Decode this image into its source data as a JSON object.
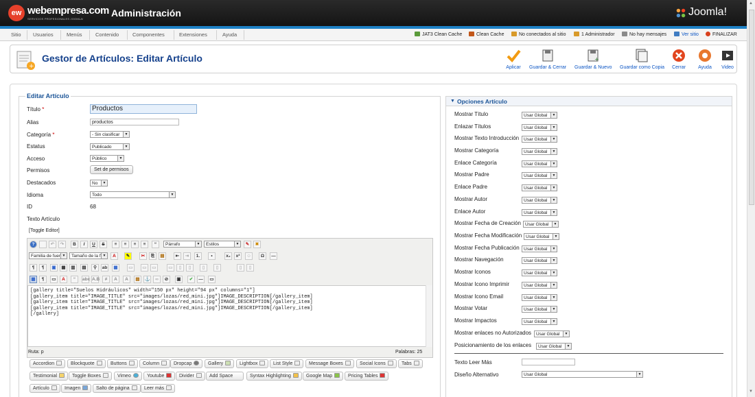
{
  "brand": {
    "logo_mark": "ew",
    "logo_text": "webempresa.com",
    "logo_sub": "SERVICIOS PROFESIONALES JOOMLA!",
    "admin_title": "Administración",
    "joomla": "Joomla!"
  },
  "menu": [
    "Sitio",
    "Usuarios",
    "Menús",
    "Contenido",
    "Componentes",
    "Extensiones",
    "Ayuda"
  ],
  "status_items": [
    "JAT3 Clean Cache",
    "Clean Cache",
    "No conectados al sitio",
    "1 Administrador",
    "No hay mensajes",
    "Ver sitio",
    "FINALIZAR"
  ],
  "page_title": "Gestor de Artículos: Editar Artículo",
  "toolbar": [
    "Aplicar",
    "Guardar & Cerrar",
    "Guardar & Nuevo",
    "Guardar como Copia",
    "Cerrar",
    "Ayuda",
    "Video"
  ],
  "form": {
    "legend": "Editar Artículo",
    "labels": {
      "titulo": "Título",
      "alias": "Alias",
      "categoria": "Categoría",
      "estatus": "Estatus",
      "acceso": "Acceso",
      "permisos": "Permisos",
      "destacados": "Destacados",
      "idioma": "Idioma",
      "id": "ID",
      "texto": "Texto Artículo"
    },
    "required_mark": "*",
    "values": {
      "titulo": "Productos",
      "alias": "productos",
      "categoria": "- Sin clasificar",
      "estatus": "Publicado",
      "acceso": "Público",
      "permisos_button": "Set de permisos",
      "destacados": "No",
      "idioma": "Todo",
      "id": "68"
    },
    "toggle_editor": "[Toggle Editor]"
  },
  "editor": {
    "format_select": "Párrafo",
    "styles_select": "Estilos",
    "font_family": "Familia de fuer",
    "font_size": "Tamaño de la fu",
    "content": "[gallery title=\"Suelos Hidráulicos\" width=\"150 px\" height=\"94 px\" columns=\"1\"]\n[gallery_item title=\"IMAGE_TITLE\" src=\"images/lozas/red_mini.jpg\"]IMAGE_DESCRIPTION[/gallery_item]\n[gallery_item title=\"IMAGE_TITLE\" src=\"images/lozas/red_mini.jpg\"]IMAGE_DESCRIPTION[/gallery_item]\n[gallery_item title=\"IMAGE_TITLE\" src=\"images/lozas/red_mini.jpg\"]IMAGE_DESCRIPTION[/gallery_item]\n[/gallery]",
    "path_label": "Ruta:",
    "path_value": "p",
    "words_label": "Palabras:",
    "words_count": "25"
  },
  "shortcode_row1": [
    "Accordion",
    "Blockquote",
    "Buttons",
    "Column",
    "Dropcap",
    "Gallery",
    "Lightbox",
    "List Style",
    "Message Boxes",
    "Social Icons",
    "Tabs"
  ],
  "shortcode_row2": [
    "Testimonial",
    "Toggle Boxes",
    "Vimeo",
    "Youtube",
    "Divider",
    "Add Space",
    "Syntax Highlighting",
    "Google Map",
    "Pricing Tables"
  ],
  "shortcode_row3": [
    "Artículo",
    "Imagen",
    "Salto de página",
    "Leer más"
  ],
  "options": {
    "title": "Opciones Artículo",
    "items": [
      {
        "label": "Mostrar Título",
        "value": "Usar Global"
      },
      {
        "label": "Enlazar Títulos",
        "value": "Usar Global"
      },
      {
        "label": "Mostrar Texto Introducción",
        "value": "Usar Global"
      },
      {
        "label": "Mostrar Categoría",
        "value": "Usar Global"
      },
      {
        "label": "Enlace Categoría",
        "value": "Usar Global"
      },
      {
        "label": "Mostrar Padre",
        "value": "Usar Global"
      },
      {
        "label": "Enlace Padre",
        "value": "Usar Global"
      },
      {
        "label": "Mostrar Autor",
        "value": "Usar Global"
      },
      {
        "label": "Enlace Autor",
        "value": "Usar Global"
      },
      {
        "label": "Mostrar Fecha de Creación",
        "value": "Usar Global"
      },
      {
        "label": "Mostrar Fecha Modificación",
        "value": "Usar Global"
      },
      {
        "label": "Mostrar Fecha Publicación",
        "value": "Usar Global"
      },
      {
        "label": "Mostrar Navegación",
        "value": "Usar Global"
      },
      {
        "label": "Mostrar Iconos",
        "value": "Usar Global"
      },
      {
        "label": "Mostrar Icono Imprimir",
        "value": "Usar Global"
      },
      {
        "label": "Mostrar Icono Email",
        "value": "Usar Global"
      },
      {
        "label": "Mostrar Votar",
        "value": "Usar Global"
      },
      {
        "label": "Mostrar Impactos",
        "value": "Usar Global"
      },
      {
        "label": "Mostrar enlaces no Autorizados",
        "value": "Usar Global"
      },
      {
        "label": "Posicionamiento de los enlaces",
        "value": "Usar Global"
      }
    ],
    "leer_mas_label": "Texto Leer Más",
    "leer_mas_value": "",
    "diseno_label": "Diseño Alternativo",
    "diseno_value": "Usar Global"
  },
  "colors": {
    "accent_blue": "#1f82c6",
    "title_blue": "#15418c",
    "logo_red": "#e6412b"
  }
}
